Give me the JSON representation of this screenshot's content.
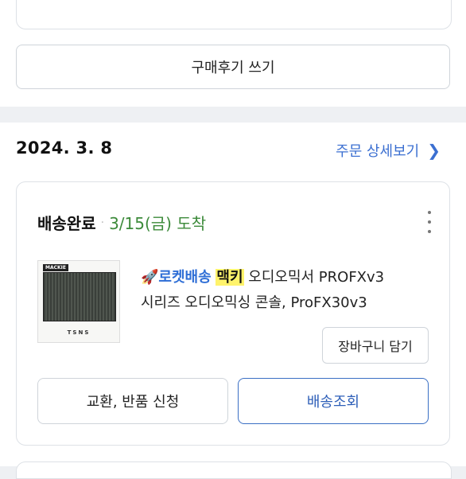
{
  "review": {
    "label": "구매후기 쓰기"
  },
  "order": {
    "date": "2024. 3. 8",
    "detail_link": "주문 상세보기",
    "detail_chevron": "❯"
  },
  "card": {
    "status": "배송완료",
    "status_separator": "·",
    "arrival": "3/15(금) 도착",
    "product": {
      "rocket_emoji": "🚀",
      "badge": "로켓배송",
      "brand_highlight": "맥키",
      "name_line1": "오디오믹서 PROFXv3",
      "name_line2": "시리즈 오디오믹싱 콘솔, ProFX30v3",
      "image_logo": "MACKIE",
      "image_tag": "TSNS"
    },
    "cart_button": "장바구니 담기",
    "exchange_button": "교환, 반품 신청",
    "track_button": "배송조회"
  },
  "colors": {
    "accent_blue": "#3b6fd1",
    "arrival_green": "#3c8a3a",
    "highlight_yellow": "#fff36b"
  }
}
